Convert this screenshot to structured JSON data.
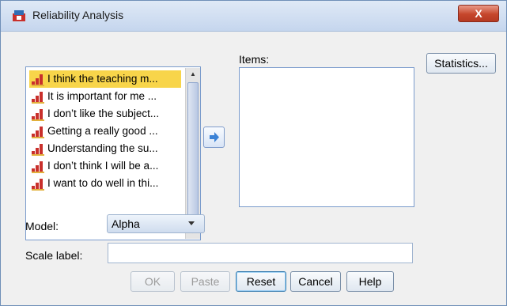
{
  "window": {
    "title": "Reliability Analysis",
    "close_label": "X"
  },
  "variables": {
    "items": [
      {
        "label": "I think the teaching m...",
        "selected": true
      },
      {
        "label": "It is important for me ...",
        "selected": false
      },
      {
        "label": "I don’t like the subject...",
        "selected": false
      },
      {
        "label": "Getting a really good ...",
        "selected": false
      },
      {
        "label": "Understanding the su...",
        "selected": false
      },
      {
        "label": "I don’t think I will be a...",
        "selected": false
      },
      {
        "label": "I want to do well in thi...",
        "selected": false
      }
    ]
  },
  "items_panel": {
    "label": "Items:"
  },
  "buttons": {
    "statistics": "Statistics...",
    "ok": "OK",
    "paste": "Paste",
    "reset": "Reset",
    "cancel": "Cancel",
    "help": "Help"
  },
  "model": {
    "label": "Model:",
    "value": "Alpha"
  },
  "scale": {
    "label": "Scale label:",
    "value": ""
  },
  "colors": {
    "selection": "#f8d54a",
    "accent": "#3b82d6"
  }
}
